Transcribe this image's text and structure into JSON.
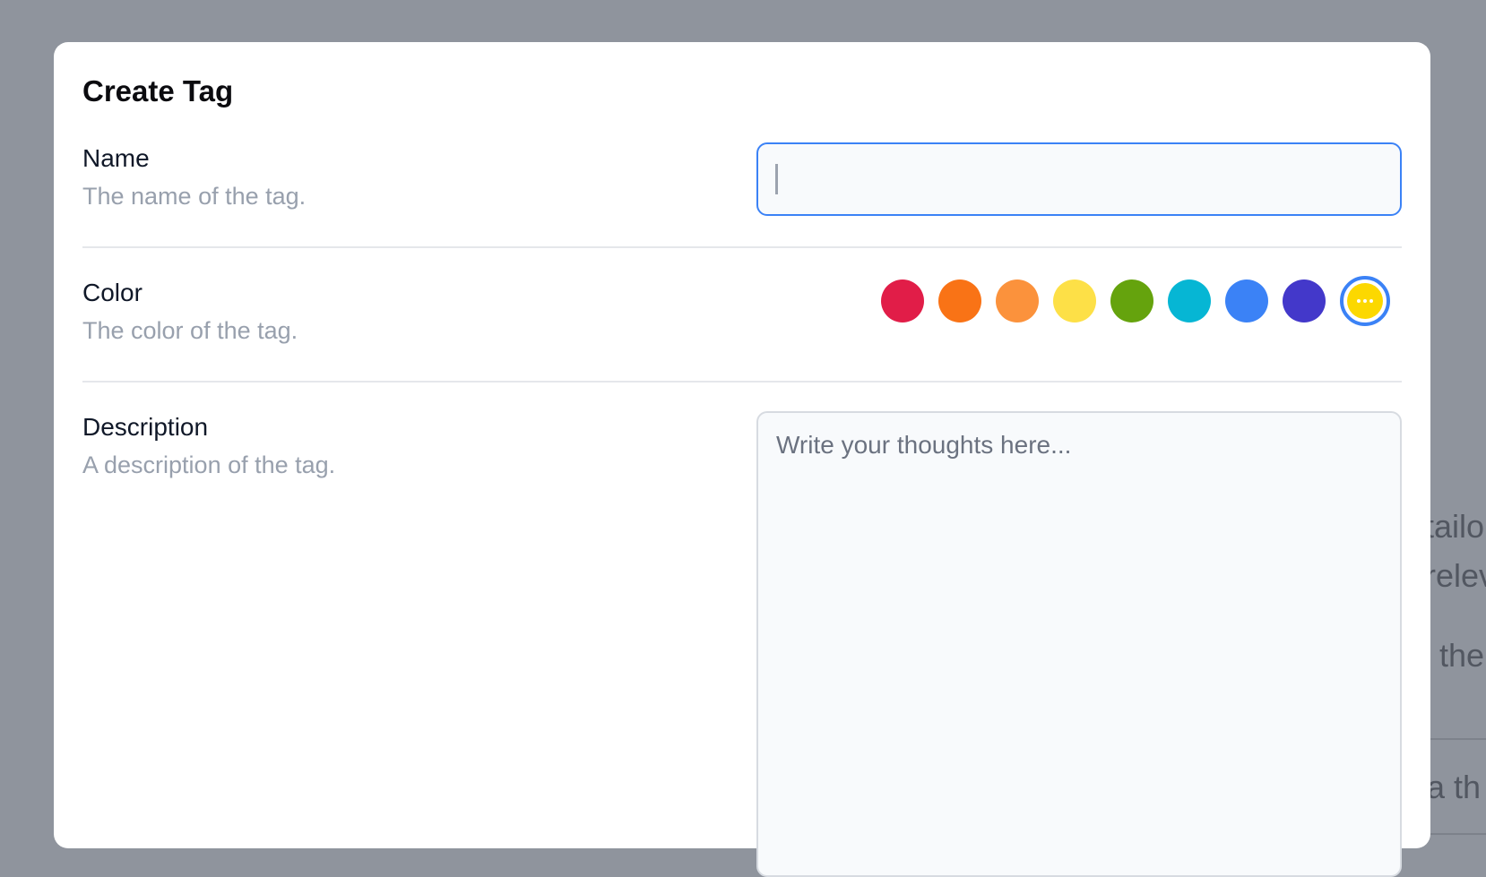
{
  "modal": {
    "title": "Create Tag",
    "name_field": {
      "label": "Name",
      "help": "The name of the tag.",
      "value": ""
    },
    "color_field": {
      "label": "Color",
      "help": "The color of the tag.",
      "swatches": [
        {
          "name": "crimson",
          "color": "#e11d48"
        },
        {
          "name": "orange",
          "color": "#f97316"
        },
        {
          "name": "light-orange",
          "color": "#fb923c"
        },
        {
          "name": "yellow",
          "color": "#fde047"
        },
        {
          "name": "green",
          "color": "#65a30d"
        },
        {
          "name": "cyan",
          "color": "#06b6d4"
        },
        {
          "name": "blue",
          "color": "#3b82f6"
        },
        {
          "name": "indigo",
          "color": "#4338ca"
        }
      ],
      "selected": {
        "name": "custom-yellow",
        "color": "#fcd800",
        "icon": "more-dots-icon"
      }
    },
    "description_field": {
      "label": "Description",
      "help": "A description of the tag.",
      "placeholder": "Write your thoughts here..."
    }
  },
  "background": {
    "fragments": [
      "tailo",
      "relev",
      "the",
      "a th"
    ]
  }
}
